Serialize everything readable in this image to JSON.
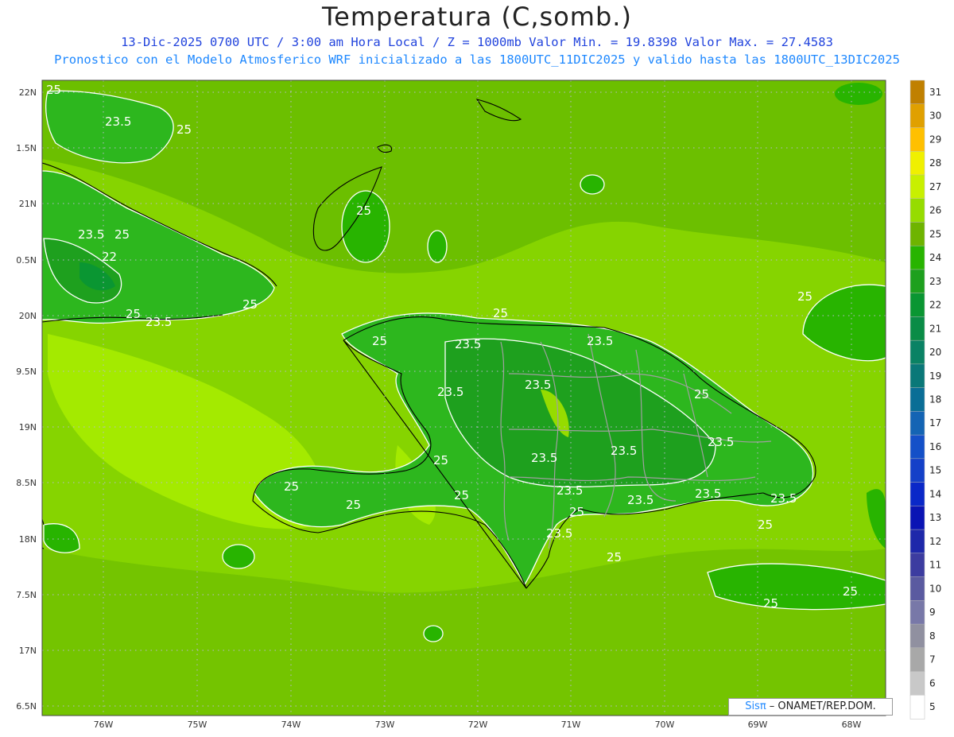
{
  "header": {
    "title": "Temperatura (C,somb.)",
    "line1": "13-Dic-2025  0700 UTC / 3:00 am Hora Local / Z = 1000mb   Valor Min. = 19.8398  Valor Max. = 27.4583",
    "line2": "Pronostico con el Modelo Atmosferico WRF inicializado a las 1800UTC_11DIC2025 y valido hasta las  1800UTC_13DIC2025"
  },
  "axes": {
    "longitude_labels": [
      "76W",
      "75W",
      "74W",
      "73W",
      "72W",
      "71W",
      "70W",
      "69W",
      "68W"
    ],
    "latitude_labels": [
      "22N",
      "1.5N",
      "21N",
      "0.5N",
      "20N",
      "9.5N",
      "19N",
      "8.5N",
      "18N",
      "7.5N",
      "17N",
      "6.5N"
    ]
  },
  "colorbar": {
    "values": [
      "31",
      "30",
      "29",
      "28",
      "27",
      "26",
      "25",
      "24",
      "23",
      "22",
      "21",
      "20",
      "19",
      "18",
      "17",
      "16",
      "15",
      "14",
      "13",
      "12",
      "11",
      "10",
      "9",
      "8",
      "7",
      "6",
      "5"
    ],
    "colors": [
      "#c08000",
      "#e0a000",
      "#ffc000",
      "#f0f000",
      "#c8f000",
      "#96dc00",
      "#6eb400",
      "#28b400",
      "#1ea01e",
      "#0a9632",
      "#0a8c46",
      "#0a8264",
      "#0a7878",
      "#0a6e96",
      "#1464b4",
      "#1450c8",
      "#1440c8",
      "#0a28c8",
      "#0a14b4",
      "#1e28aa",
      "#3c3ca0",
      "#5a5aa0",
      "#7878a8",
      "#9090a0",
      "#a8a8a8",
      "#c8c8c8",
      "#ffffff"
    ]
  },
  "contour_labels": [
    "25",
    "23.5",
    "22"
  ],
  "credit": {
    "brand": "Sisπ",
    "org": " – ONAMET/REP.DOM."
  },
  "colors": {
    "background_sea": "#86d400",
    "land_warm": "#28b400",
    "mid": "#6eb400",
    "warm_sea": "#b4f000"
  }
}
